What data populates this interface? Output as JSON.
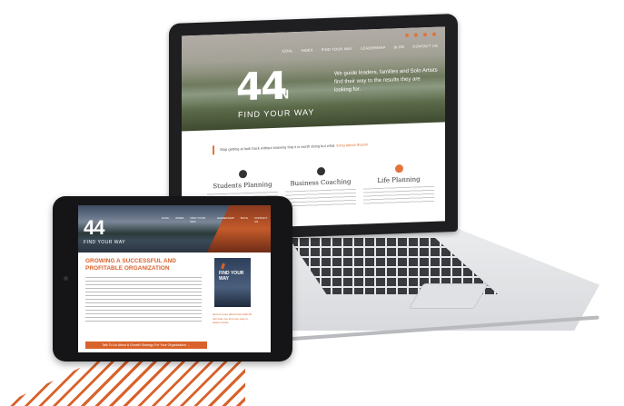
{
  "brand": {
    "logo_number": "44",
    "logo_letter": "N",
    "tagline": "FIND YOUR WAY",
    "accent_color": "#d9622b"
  },
  "laptop": {
    "nav": [
      "GOAL",
      "INDEX",
      "FIND YOUR WAY",
      "LEADERSHIP",
      "BLOG",
      "CONTACT US"
    ],
    "hero_text": "We guide leaders, families and Solo Artists find their way to the results they are looking for.",
    "quote": "Stop getting at look back without knowing that it is worth doing but what.",
    "quote_link": "living above illusion",
    "columns": [
      {
        "title": "Students Planning"
      },
      {
        "title": "Business Coaching"
      },
      {
        "title": "Life Planning"
      }
    ]
  },
  "tablet": {
    "nav": [
      "GOAL",
      "INDEX",
      "FIND YOUR WAY",
      "LEADERSHIP",
      "BLOG",
      "CONTACT US"
    ],
    "heading": "GROWING A SUCCESSFUL AND PROFITABLE ORGANIZATION",
    "book_title": "FIND YOUR WAY",
    "book_caption": "Here is more about how 44North can help you find your way to better results.",
    "cta": "Talk To Us About A Growth Strategy For Your Organization →"
  }
}
